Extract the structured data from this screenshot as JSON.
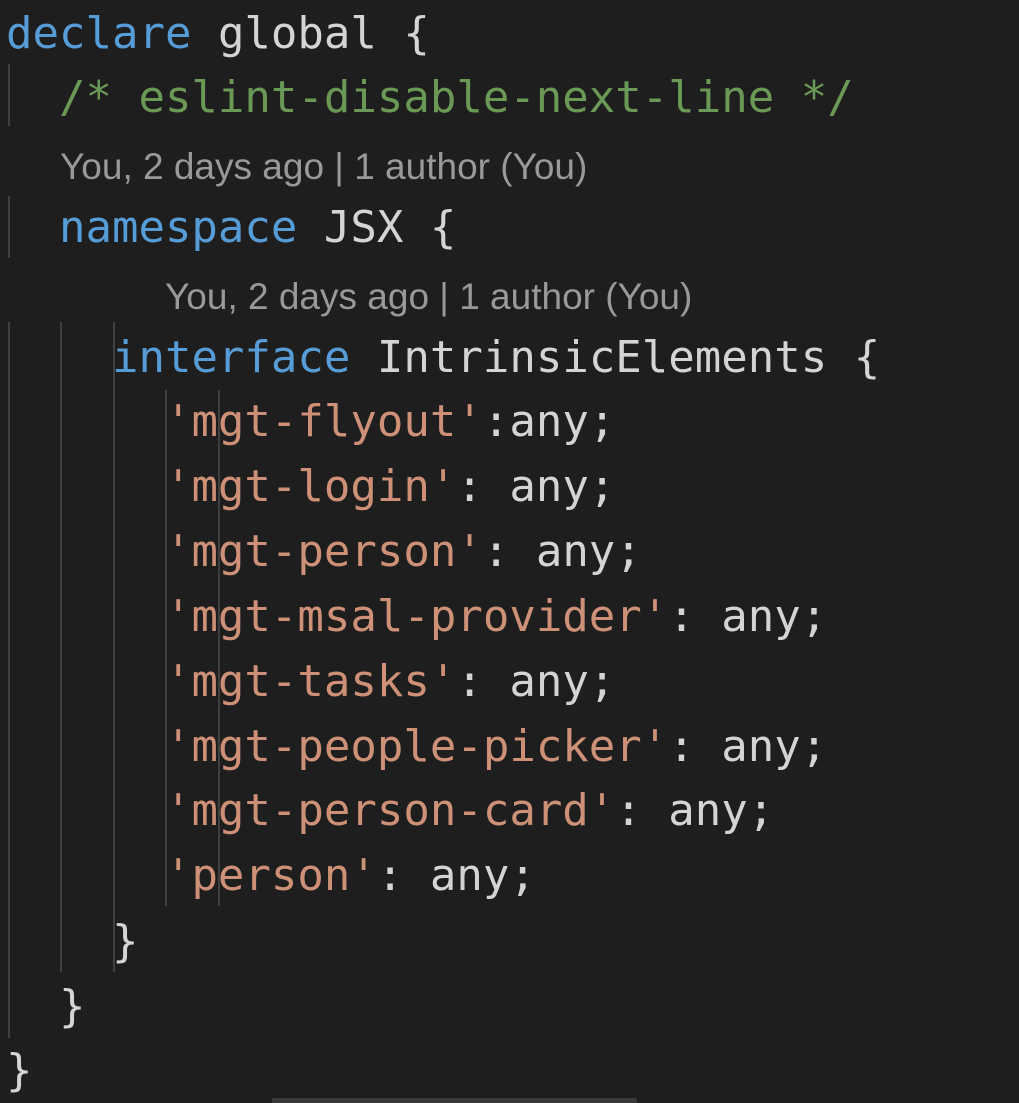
{
  "editor": {
    "codelens_label": "You, 2 days ago | 1 author (You)",
    "lines": {
      "declare_kw": "declare",
      "global_id": "global",
      "open_brace": "{",
      "eslint_comment": "/* eslint-disable-next-line */",
      "namespace_kw": "namespace",
      "namespace_name": "JSX",
      "interface_kw": "interface",
      "interface_name": "IntrinsicElements",
      "close_brace": "}"
    },
    "properties": [
      {
        "key": "'mgt-flyout'",
        "sep": ":",
        "value": "any;"
      },
      {
        "key": "'mgt-login'",
        "sep": ": ",
        "value": "any;"
      },
      {
        "key": "'mgt-person'",
        "sep": ": ",
        "value": "any;"
      },
      {
        "key": "'mgt-msal-provider'",
        "sep": ": ",
        "value": "any;"
      },
      {
        "key": "'mgt-tasks'",
        "sep": ": ",
        "value": "any;"
      },
      {
        "key": "'mgt-people-picker'",
        "sep": ": ",
        "value": "any;"
      },
      {
        "key": "'mgt-person-card'",
        "sep": ": ",
        "value": "any;"
      },
      {
        "key": "'person'",
        "sep": ": ",
        "value": "any;"
      }
    ]
  },
  "colors": {
    "background": "#1e1e1e",
    "keyword": "#569cd6",
    "identifier": "#d4d4d4",
    "comment": "#6a9955",
    "string": "#ce9178",
    "codelens": "#999999"
  }
}
